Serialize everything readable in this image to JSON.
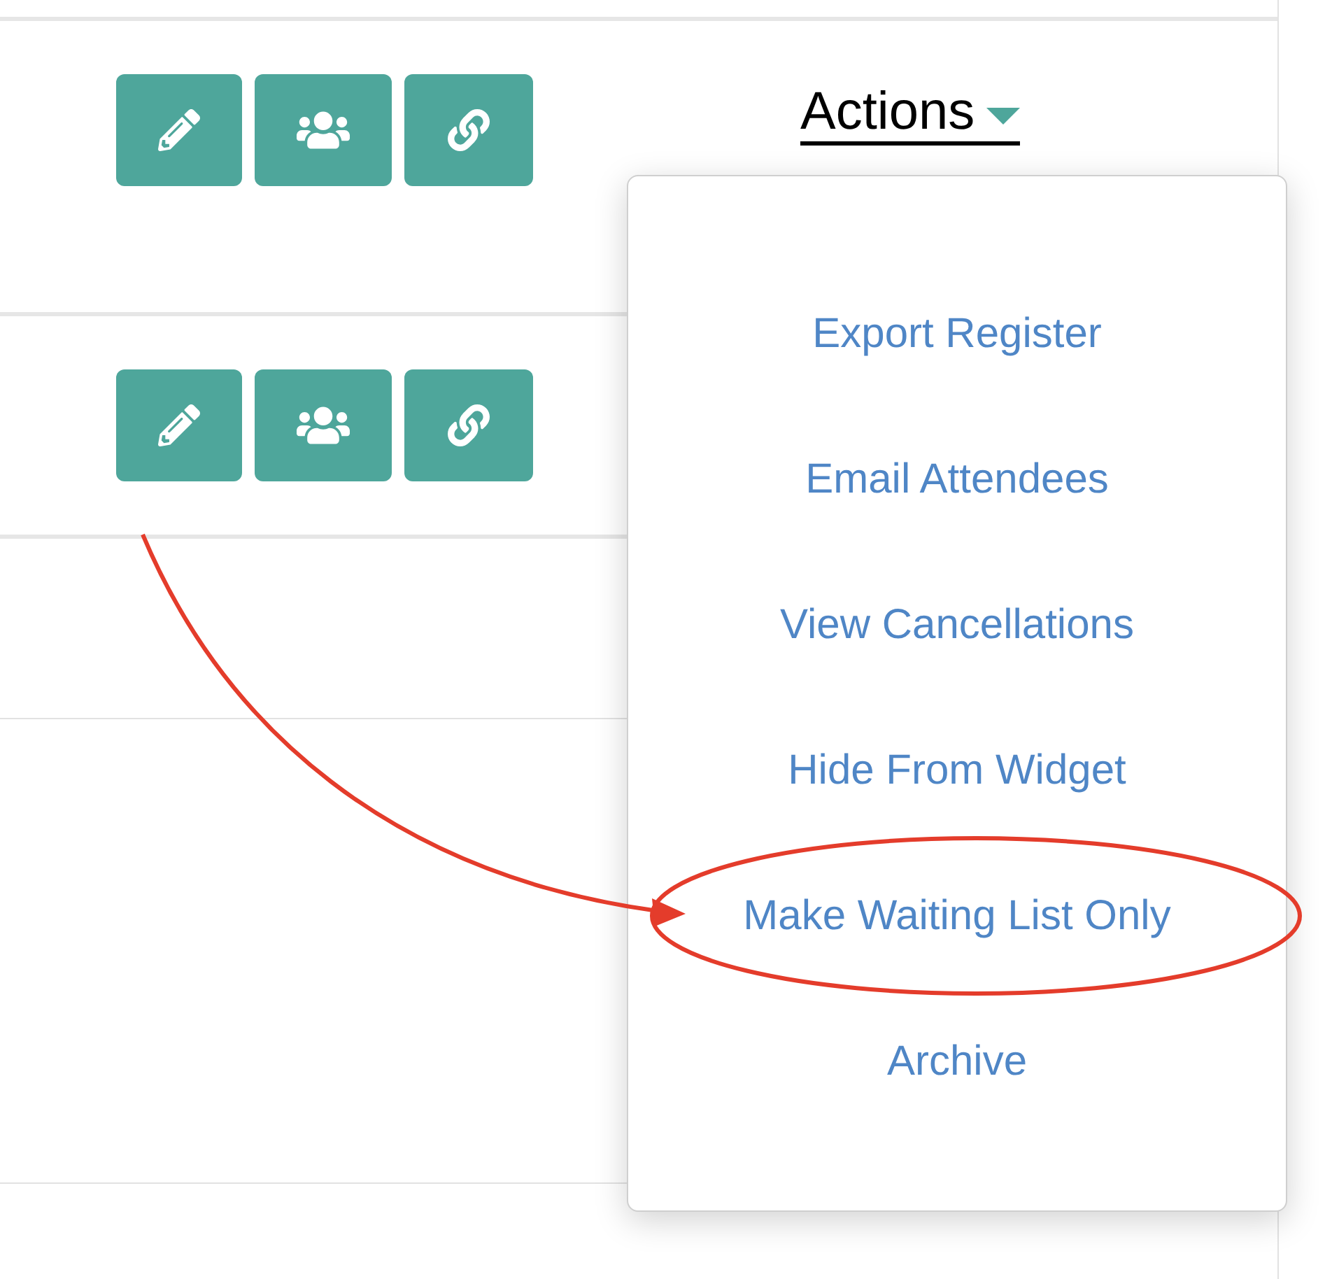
{
  "rows": [
    {
      "buttons": [
        {
          "kind": "edit"
        },
        {
          "kind": "attendees"
        },
        {
          "kind": "link"
        }
      ],
      "actions_label": "Actions"
    },
    {
      "buttons": [
        {
          "kind": "edit"
        },
        {
          "kind": "attendees"
        },
        {
          "kind": "link"
        }
      ]
    }
  ],
  "actions_menu": {
    "items": [
      {
        "label": "Export Register",
        "highlighted": false
      },
      {
        "label": "Email Attendees",
        "highlighted": false
      },
      {
        "label": "View Cancellations",
        "highlighted": false
      },
      {
        "label": "Hide From Widget",
        "highlighted": false
      },
      {
        "label": "Make Waiting List Only",
        "highlighted": true
      },
      {
        "label": "Archive",
        "highlighted": false
      }
    ]
  }
}
